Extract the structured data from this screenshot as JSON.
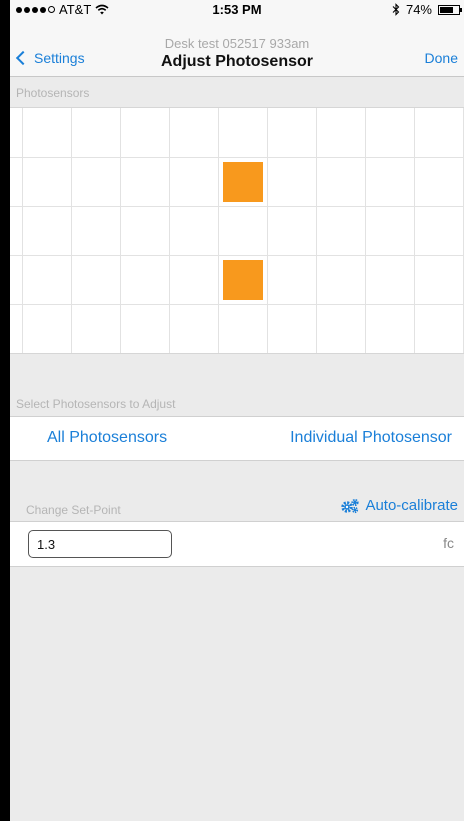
{
  "status_bar": {
    "carrier": "AT&T",
    "time": "1:53 PM",
    "battery": "74%",
    "battery_level": 0.74,
    "icons": [
      "signal-dots-icon",
      "wifi-icon",
      "bluetooth-icon",
      "battery-icon"
    ]
  },
  "nav": {
    "back_label": "Settings",
    "subtitle": "Desk test 052517 933am",
    "title": "Adjust Photosensor",
    "done_label": "Done"
  },
  "photosensors": {
    "section_label": "Photosensors",
    "sensor_color": "#f8991d"
  },
  "select": {
    "section_label": "Select Photosensors to Adjust",
    "all_label": "All Photosensors",
    "individual_label": "Individual Photosensor"
  },
  "setpoint": {
    "section_label": "Change Set-Point",
    "auto_calibrate_label": "Auto-calibrate",
    "value": "1.3",
    "unit": "fc"
  },
  "colors": {
    "accent": "#1a7fd8",
    "sensor": "#f8991d",
    "background": "#ebebeb"
  }
}
